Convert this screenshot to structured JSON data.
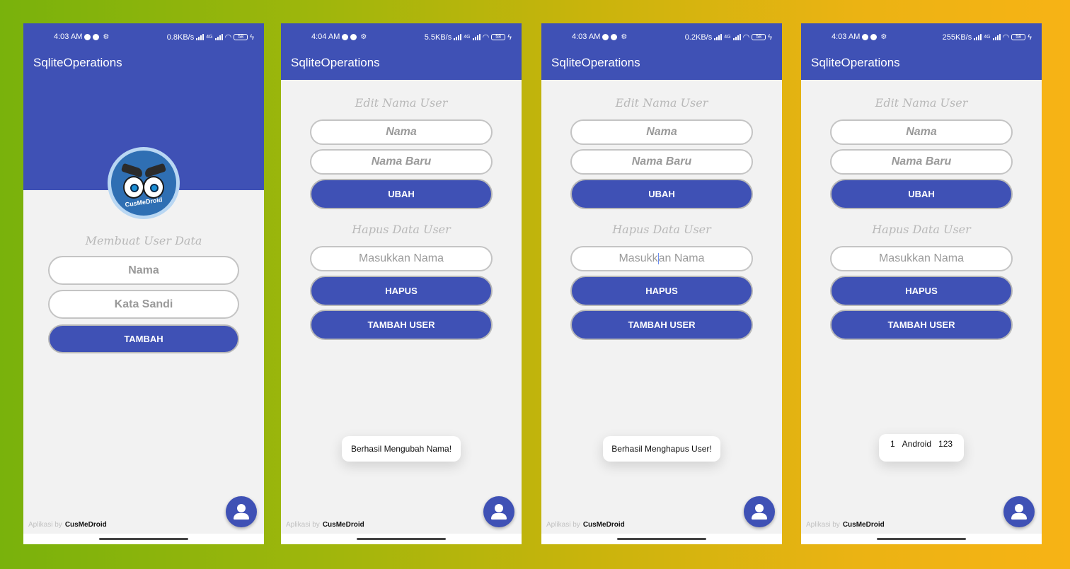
{
  "app_title": "SqliteOperations",
  "footer": {
    "by": "Aplikasi by",
    "brand": "CusMeDroid"
  },
  "brand_color": "#3f51b5",
  "fab_icon": "person-icon",
  "phones": [
    {
      "status": {
        "time": "4:03 AM",
        "speed": "0.8KB/s",
        "network": "4G",
        "battery": "58"
      },
      "logo_text": "CusMeDroid",
      "section_title": "Membuat User Data",
      "name_placeholder": "Nama",
      "password_placeholder": "Kata Sandi",
      "add_button": "TAMBAH"
    },
    {
      "status": {
        "time": "4:04 AM",
        "speed": "5.5KB/s",
        "network": "4G",
        "battery": "58"
      },
      "edit_title": "Edit Nama User",
      "name_placeholder": "Nama",
      "new_name_placeholder": "Nama Baru",
      "change_button": "UBAH",
      "delete_title": "Hapus Data User",
      "delete_placeholder": "Masukkan Nama",
      "delete_button": "HAPUS",
      "add_user_button": "TAMBAH USER",
      "toast": "Berhasil Mengubah Nama!"
    },
    {
      "status": {
        "time": "4:03 AM",
        "speed": "0.2KB/s",
        "network": "4G",
        "battery": "58"
      },
      "edit_title": "Edit Nama User",
      "name_placeholder": "Nama",
      "new_name_placeholder": "Nama Baru",
      "change_button": "UBAH",
      "delete_title": "Hapus Data User",
      "delete_placeholder_a": "Masukk",
      "delete_placeholder_b": "an Nama",
      "delete_button": "HAPUS",
      "add_user_button": "TAMBAH USER",
      "toast": "Berhasil Menghapus User!"
    },
    {
      "status": {
        "time": "4:03 AM",
        "speed": "255KB/s",
        "network": "4G",
        "battery": "58"
      },
      "edit_title": "Edit Nama User",
      "name_placeholder": "Nama",
      "new_name_placeholder": "Nama Baru",
      "change_button": "UBAH",
      "delete_title": "Hapus Data User",
      "delete_placeholder": "Masukkan Nama",
      "delete_button": "HAPUS",
      "add_user_button": "TAMBAH USER",
      "toast_row": {
        "id": "1",
        "name": "Android",
        "password": "123"
      }
    }
  ]
}
